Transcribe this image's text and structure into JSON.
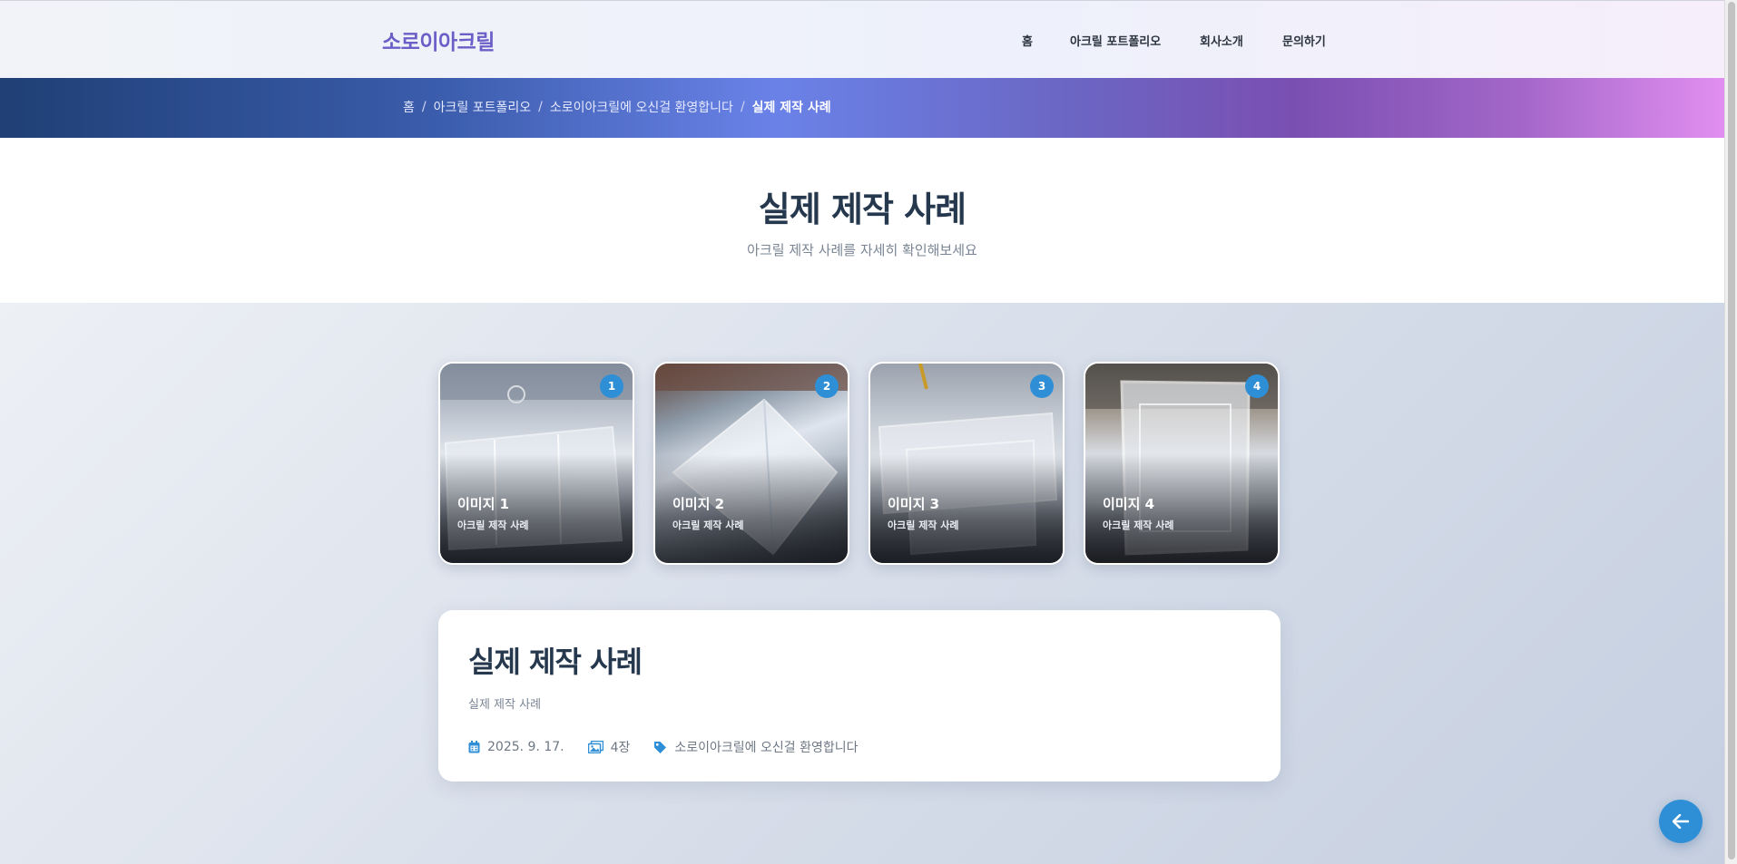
{
  "header": {
    "brand": "소로이아크릴",
    "nav": [
      "홈",
      "아크릴 포트폴리오",
      "회사소개",
      "문의하기"
    ]
  },
  "breadcrumb": {
    "items": [
      "홈",
      "아크릴 포트폴리오",
      "소로이아크릴에 오신걸 환영합니다"
    ],
    "current": "실제 제작 사례",
    "separator": "/"
  },
  "page": {
    "title": "실제 제작 사례",
    "subtitle": "아크릴 제작 사례를 자세히 확인해보세요"
  },
  "gallery": [
    {
      "badge": "1",
      "title": "이미지 1",
      "caption": "아크릴 제작 사례"
    },
    {
      "badge": "2",
      "title": "이미지 2",
      "caption": "아크릴 제작 사례"
    },
    {
      "badge": "3",
      "title": "이미지 3",
      "caption": "아크릴 제작 사례"
    },
    {
      "badge": "4",
      "title": "이미지 4",
      "caption": "아크릴 제작 사례"
    }
  ],
  "info": {
    "title": "실제 제작 사례",
    "subtitle": "실제 제작 사례",
    "date": "2025. 9. 17.",
    "count": "4장",
    "category": "소로이아크릴에 오신걸 환영합니다"
  },
  "colors": {
    "brand": "#6b5fc7",
    "accent": "#2f8fd6",
    "heading": "#26384d"
  },
  "icons": {
    "date": "calendar-icon",
    "count": "images-icon",
    "category": "tag-icon",
    "back": "arrow-left-icon"
  }
}
